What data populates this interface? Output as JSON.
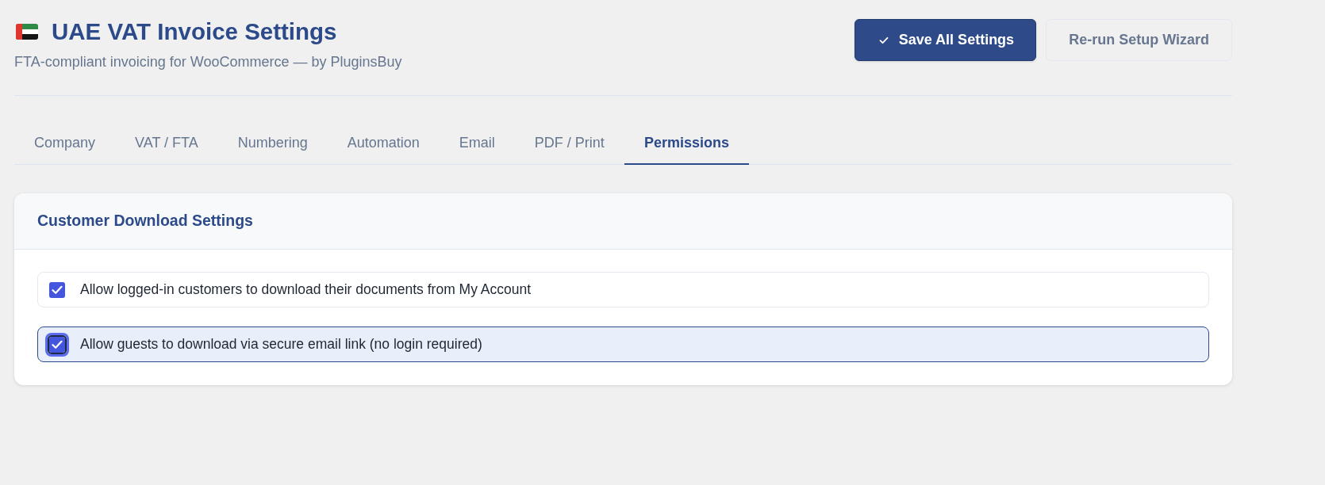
{
  "header": {
    "title": "UAE VAT Invoice Settings",
    "subtitle": "FTA-compliant invoicing for WooCommerce — by PluginsBuy"
  },
  "actions": [
    {
      "label": "Save All Settings",
      "kind": "primary"
    },
    {
      "label": "Re-run Setup Wizard",
      "kind": "secondary"
    }
  ],
  "tabs": [
    {
      "label": "Company",
      "selected": false
    },
    {
      "label": "VAT / FTA",
      "selected": false
    },
    {
      "label": "Numbering",
      "selected": false
    },
    {
      "label": "Automation",
      "selected": false
    },
    {
      "label": "Email",
      "selected": false
    },
    {
      "label": "PDF / Print",
      "selected": false
    },
    {
      "label": "Permissions",
      "selected": true
    }
  ],
  "section": {
    "title": "Customer Download Settings",
    "options": [
      {
        "label": "Allow logged-in customers to download their documents from My Account",
        "checked": true,
        "focused": false
      },
      {
        "label": "Allow guests to download via secure email link (no login required)",
        "checked": true,
        "focused": true
      }
    ]
  }
}
